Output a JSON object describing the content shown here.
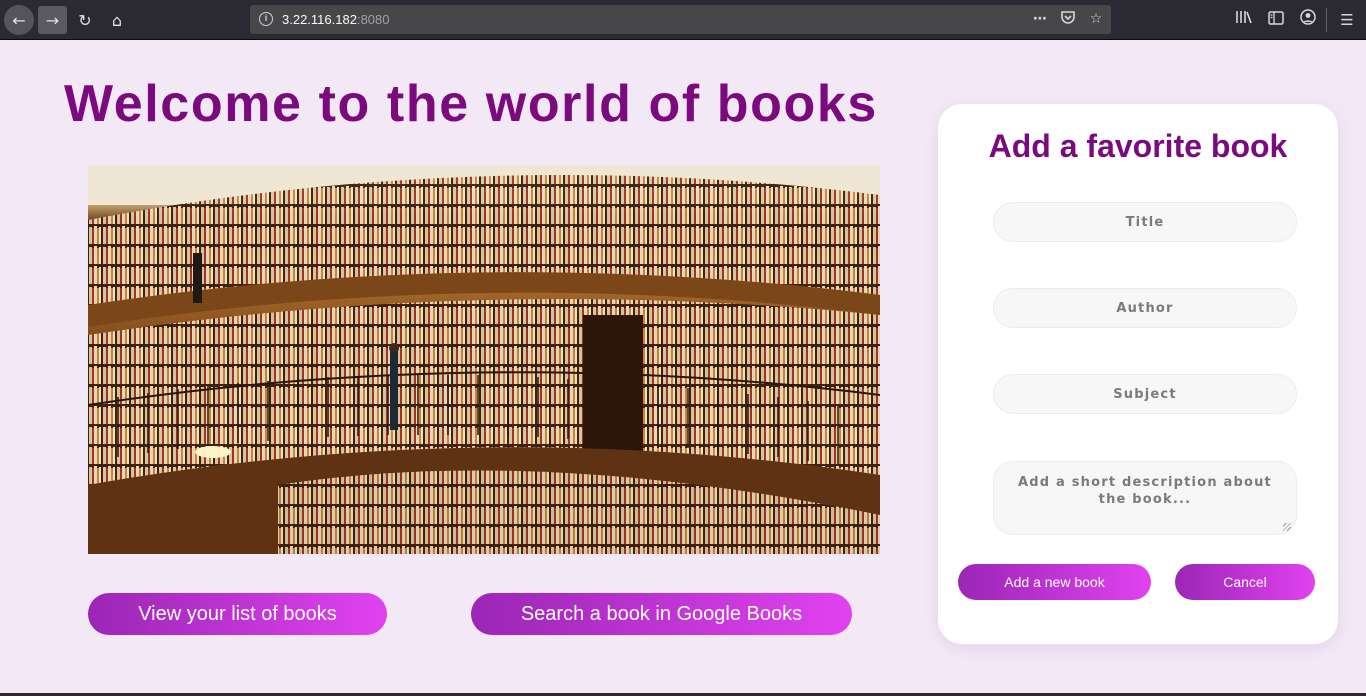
{
  "browser": {
    "url_host": "3.22.116.182",
    "url_port": ":8080",
    "icons": {
      "back": "back-arrow-icon",
      "forward": "forward-arrow-icon",
      "reload": "reload-icon",
      "home": "home-icon",
      "info": "info-icon",
      "more": "more-icon",
      "pocket": "pocket-icon",
      "bookmark": "star-icon",
      "library": "library-icon",
      "sidebar": "sidebar-icon",
      "account": "account-icon",
      "menu": "hamburger-menu-icon"
    }
  },
  "page": {
    "title": "Welcome to the world of books",
    "hero_image": "library-bookshelves-image",
    "buttons": {
      "view_list": "View your list of books",
      "search_google": "Search a book in Google Books"
    }
  },
  "form": {
    "title": "Add a favorite book",
    "title_placeholder": "Title",
    "author_placeholder": "Author",
    "subject_placeholder": "Subject",
    "description_placeholder": "Add a short description about the book...",
    "add_label": "Add a new book",
    "cancel_label": "Cancel"
  },
  "colors": {
    "page_background": "#f3e9f6",
    "heading": "#7a0a7e",
    "button_gradient_start": "#9b26b6",
    "button_gradient_end": "#e142f0",
    "browser_chrome": "#2b2a33"
  }
}
